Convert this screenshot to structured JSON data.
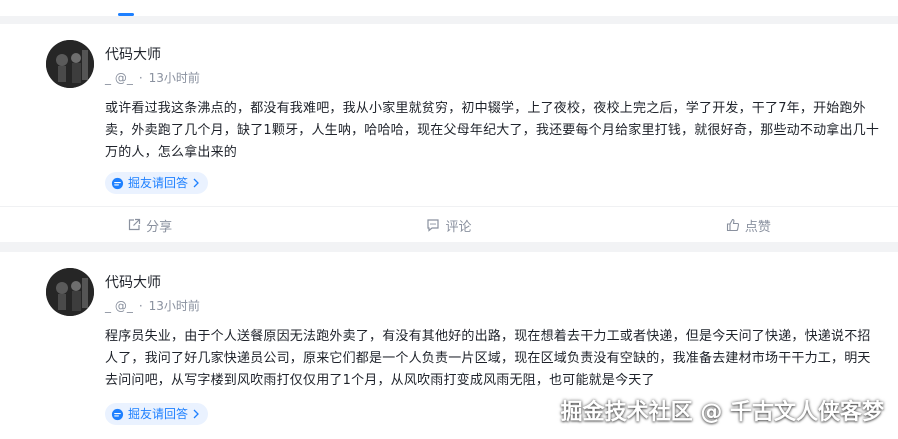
{
  "posts": [
    {
      "author_name": "代码大师",
      "username": "_ @_",
      "separator": "·",
      "time": "13小时前",
      "content": "或许看过我这条沸点的，都没有我难吧，我从小家里就贫穷，初中辍学，上了夜校，夜校上完之后，学了开发，干了7年，开始跑外卖，外卖跑了几个月，缺了1颗牙，人生呐，哈哈哈，现在父母年纪大了，我还要每个月给家里打钱，就很好奇，那些动不动拿出几十万的人，怎么拿出来的",
      "invite_label": "掘友请回答",
      "actions": {
        "share": "分享",
        "comment": "评论",
        "like": "点赞"
      }
    },
    {
      "author_name": "代码大师",
      "username": "_ @_",
      "separator": "·",
      "time": "13小时前",
      "content": "程序员失业，由于个人送餐原因无法跑外卖了，有没有其他好的出路，现在想着去干力工或者快递，但是今天问了快递，快递说不招人了，我问了好几家快递员公司，原来它们都是一个人负责一片区域，现在区域负责没有空缺的，我准备去建材市场干干力工，明天去问问吧，从写字楼到风吹雨打仅仅用了1个月，从风吹雨打变成风雨无阻，也可能就是今天了",
      "invite_label": "掘友请回答"
    }
  ],
  "watermark": "掘金技术社区 @ 千古文人侠客梦",
  "colors": {
    "accent": "#1e80ff",
    "text": "#1d2129",
    "muted": "#8a919f",
    "tag_bg": "#eaf2ff",
    "page_bg": "#f2f3f5"
  },
  "icons": [
    "chat-bubble-icon",
    "chevron-right-icon",
    "share-icon",
    "comment-icon",
    "thumbs-up-icon"
  ]
}
